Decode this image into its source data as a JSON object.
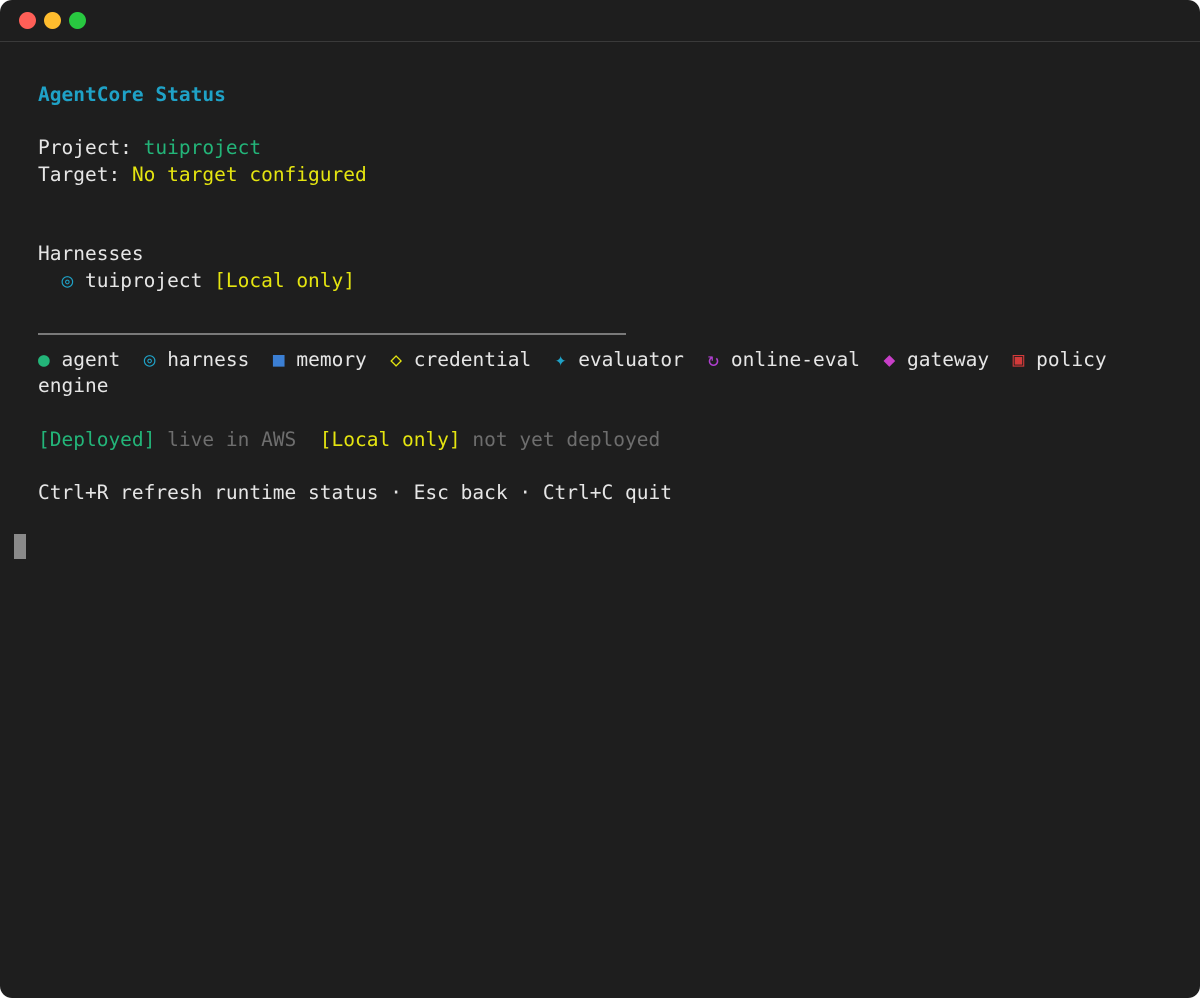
{
  "window": {
    "controls": [
      "close",
      "minimize",
      "maximize"
    ]
  },
  "header": {
    "title": "AgentCore Status"
  },
  "project": {
    "label": "Project:",
    "value": "tuiproject"
  },
  "target": {
    "label": "Target:",
    "value": "No target configured"
  },
  "harnesses": {
    "heading": "Harnesses",
    "items": [
      {
        "icon": "◎",
        "name": "tuiproject",
        "status": "[Local only]"
      }
    ]
  },
  "legend": {
    "items": [
      {
        "icon": "●",
        "label": "agent"
      },
      {
        "icon": "◎",
        "label": "harness"
      },
      {
        "icon": "■",
        "label": "memory"
      },
      {
        "icon": "◇",
        "label": "credential"
      },
      {
        "icon": "✦",
        "label": "evaluator"
      },
      {
        "icon": "↻",
        "label": "online-eval"
      },
      {
        "icon": "◆",
        "label": "gateway"
      },
      {
        "icon": "▣",
        "label": "policy"
      }
    ],
    "wrap_text": "engine"
  },
  "status_legend": {
    "deployed_tag": "[Deployed]",
    "deployed_desc": "live in AWS",
    "local_tag": "[Local only]",
    "local_desc": "not yet deployed"
  },
  "shortcuts": {
    "text": "Ctrl+R refresh runtime status · Esc back · Ctrl+C quit"
  },
  "colors": {
    "background": "#1e1e1e",
    "accent_cyan": "#1fa2c7",
    "green": "#23b579",
    "yellow": "#e5e510"
  }
}
